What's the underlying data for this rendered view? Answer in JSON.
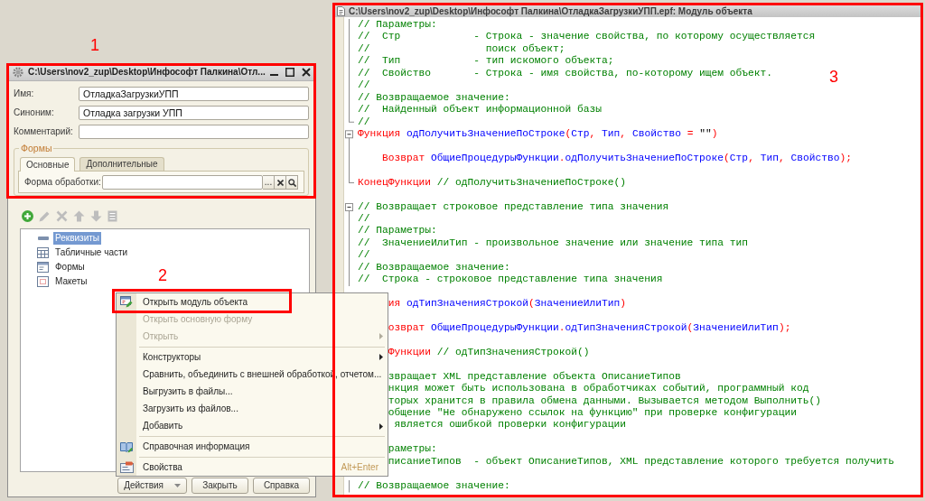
{
  "annotations": [
    {
      "number": "1"
    },
    {
      "number": "2"
    },
    {
      "number": "3"
    }
  ],
  "properties_window": {
    "title": "C:\\Users\\nov2_zup\\Desktop\\Инфософт Палкина\\Отл...",
    "fields": [
      {
        "label": "Имя:",
        "value": "ОтладкаЗагрузкиУПП"
      },
      {
        "label": "Синоним:",
        "value": "Отладка загрузки УПП"
      },
      {
        "label": "Комментарий:"
      }
    ],
    "group": {
      "title": "Формы",
      "tabs": [
        {
          "label": "Основные",
          "selected": true
        },
        {
          "label": "Дополнительные",
          "selected": false
        }
      ],
      "field": {
        "label": "Форма обработки:",
        "choose_button": "..."
      }
    },
    "toolbar": [
      {
        "kind": "add",
        "disabled": false
      },
      {
        "kind": "edit",
        "disabled": true
      },
      {
        "kind": "delete",
        "disabled": true
      },
      {
        "kind": "up",
        "disabled": true
      },
      {
        "kind": "down",
        "disabled": true
      },
      {
        "kind": "list",
        "disabled": true
      }
    ],
    "tree": [
      {
        "kind": "attributes",
        "label": "Реквизиты",
        "selected": true
      },
      {
        "kind": "tables",
        "label": "Табличные части",
        "selected": false
      },
      {
        "kind": "forms",
        "label": "Формы",
        "selected": false
      },
      {
        "kind": "templates",
        "label": "Макеты",
        "selected": false
      }
    ],
    "buttons": [
      {
        "kind": "dropdown",
        "label": "Действия"
      },
      {
        "kind": "plain",
        "label": "Закрыть"
      },
      {
        "kind": "plain",
        "label": "Справка"
      }
    ]
  },
  "context_menu": {
    "items": [
      {
        "kind": "module",
        "label": "Открыть модуль объекта",
        "disabled": false,
        "submenu": false
      },
      {
        "kind": "command",
        "label": "Открыть основную форму",
        "disabled": true,
        "submenu": false
      },
      {
        "kind": "command",
        "label": "Открыть",
        "disabled": true,
        "submenu": true
      },
      {
        "kind": "separator"
      },
      {
        "kind": "command",
        "label": "Конструкторы",
        "disabled": false,
        "submenu": true
      },
      {
        "kind": "command",
        "label": "Сравнить, объединить с внешней обработкой, отчетом...",
        "disabled": false,
        "submenu": false
      },
      {
        "kind": "command",
        "label": "Выгрузить в файлы...",
        "disabled": false,
        "submenu": false
      },
      {
        "kind": "command",
        "label": "Загрузить из файлов...",
        "disabled": false,
        "submenu": false
      },
      {
        "kind": "command",
        "label": "Добавить",
        "disabled": false,
        "submenu": true
      },
      {
        "kind": "separator"
      },
      {
        "kind": "help",
        "label": "Справочная информация",
        "disabled": false,
        "submenu": false
      },
      {
        "kind": "separator"
      },
      {
        "kind": "properties",
        "label": "Свойства",
        "disabled": false,
        "submenu": false,
        "shortcut": "Alt+Enter"
      }
    ]
  },
  "code_window": {
    "title": "C:\\Users\\nov2_zup\\Desktop\\Инфософт Палкина\\ОтладкаЗагрузкиУПП.epf: Модуль объекта",
    "lines": [
      {
        "kind": "region",
        "has_toggle": false,
        "has_end": true,
        "children": [
          {
            "kind": "comment",
            "text": "// Параметры:",
            "covered": false
          },
          {
            "kind": "comment",
            "text": "//  Стр            - Строка - значение свойства, по которому осуществляется",
            "covered": false
          },
          {
            "kind": "comment",
            "text": "//                   поиск объект;",
            "covered": false
          },
          {
            "kind": "comment",
            "text": "//  Тип            - тип искомого объекта;",
            "covered": false
          },
          {
            "kind": "comment",
            "text": "//  Свойство       - Строка - имя свойства, по-которому ищем объект.",
            "covered": false
          },
          {
            "kind": "comment",
            "text": "//",
            "covered": false
          },
          {
            "kind": "comment",
            "text": "// Возвращаемое значение:",
            "covered": false
          },
          {
            "kind": "comment",
            "text": "//  Найденный объект информационной базы",
            "covered": false
          },
          {
            "kind": "comment",
            "text": "//",
            "covered": false
          }
        ]
      },
      {
        "kind": "region",
        "has_toggle": true,
        "has_end": true,
        "children": [
          {
            "kind": "code",
            "tokens": [
              {
                "kind": "keyword",
                "text": "Функция"
              },
              {
                "kind": "name",
                "text": " одПолучитьЗначениеПоСтроке"
              },
              {
                "kind": "op",
                "text": "("
              },
              {
                "kind": "name",
                "text": "Стр"
              },
              {
                "kind": "op",
                "text": ","
              },
              {
                "kind": "name",
                "text": " Тип"
              },
              {
                "kind": "op",
                "text": ","
              },
              {
                "kind": "name",
                "text": " Свойство "
              },
              {
                "kind": "op",
                "text": "="
              },
              {
                "kind": "string",
                "text": " \"\""
              },
              {
                "kind": "op",
                "text": ")"
              }
            ],
            "covered": false
          },
          {
            "kind": "blank"
          },
          {
            "kind": "code",
            "tokens": [
              {
                "kind": "keyword",
                "text": "    Возврат"
              },
              {
                "kind": "name",
                "text": " ОбщиеПроцедурыФункции"
              },
              {
                "kind": "op",
                "text": "."
              },
              {
                "kind": "name",
                "text": "одПолучитьЗначениеПоСтроке"
              },
              {
                "kind": "op",
                "text": "("
              },
              {
                "kind": "name",
                "text": "Стр"
              },
              {
                "kind": "op",
                "text": ","
              },
              {
                "kind": "name",
                "text": " Тип"
              },
              {
                "kind": "op",
                "text": ","
              },
              {
                "kind": "name",
                "text": " Свойство"
              },
              {
                "kind": "op",
                "text": ");"
              }
            ],
            "covered": false
          },
          {
            "kind": "blank"
          },
          {
            "kind": "code",
            "tokens": [
              {
                "kind": "keyword",
                "text": "КонецФункции"
              },
              {
                "kind": "comment",
                "text": " // одПолучитьЗначениеПоСтроке()"
              }
            ],
            "covered": false
          }
        ]
      },
      {
        "kind": "blank"
      },
      {
        "kind": "region",
        "has_toggle": true,
        "has_end": false,
        "children": [
          {
            "kind": "comment",
            "text": "// Возвращает строковое представление типа значения",
            "covered": false
          },
          {
            "kind": "comment",
            "text": "//",
            "covered": false
          },
          {
            "kind": "comment",
            "text": "// Параметры:",
            "covered": false
          },
          {
            "kind": "comment",
            "text": "//  ЗначениеИлиТип - произвольное значение или значение типа тип",
            "covered": false
          },
          {
            "kind": "comment",
            "text": "//",
            "covered": false
          },
          {
            "kind": "comment",
            "text": "// Возвращаемое значение:",
            "covered": false
          },
          {
            "kind": "comment",
            "text": "//  Строка - строковое представление типа значения",
            "covered": false
          }
        ]
      },
      {
        "kind": "blank"
      },
      {
        "kind": "code",
        "tokens": [
          {
            "kind": "keyword",
            "text": "ия"
          },
          {
            "kind": "name",
            "text": " одТипЗначенияСтрокой"
          },
          {
            "kind": "op",
            "text": "("
          },
          {
            "kind": "name",
            "text": "ЗначениеИлиТип"
          },
          {
            "kind": "op",
            "text": ")"
          }
        ],
        "covered": true
      },
      {
        "kind": "blank"
      },
      {
        "kind": "code",
        "tokens": [
          {
            "kind": "keyword",
            "text": "озврат"
          },
          {
            "kind": "name",
            "text": " ОбщиеПроцедурыФункции"
          },
          {
            "kind": "op",
            "text": "."
          },
          {
            "kind": "name",
            "text": "одТипЗначенияСтрокой"
          },
          {
            "kind": "op",
            "text": "("
          },
          {
            "kind": "name",
            "text": "ЗначениеИлиТип"
          },
          {
            "kind": "op",
            "text": ");"
          }
        ],
        "covered": true
      },
      {
        "kind": "blank"
      },
      {
        "kind": "code",
        "tokens": [
          {
            "kind": "keyword",
            "text": "Функции"
          },
          {
            "kind": "comment",
            "text": " // одТипЗначенияСтрокой()"
          }
        ],
        "covered": true
      },
      {
        "kind": "blank"
      },
      {
        "kind": "comment",
        "text": "звращает XML представление объекта ОписаниеТипов",
        "covered": true
      },
      {
        "kind": "comment",
        "text": "нкция может быть использована в обработчиках событий, программный код",
        "covered": true
      },
      {
        "kind": "comment",
        "text": "торых хранится в правила обмена данными. Вызывается методом Выполнить()",
        "covered": true
      },
      {
        "kind": "comment",
        "text": "общение \"Не обнаружено ссылок на функцию\" при проверке конфигурации",
        "covered": true
      },
      {
        "kind": "comment",
        "text": " является ошибкой проверки конфигурации",
        "covered": true
      },
      {
        "kind": "blank"
      },
      {
        "kind": "comment",
        "text": "раметры:",
        "covered": true
      },
      {
        "kind": "comment",
        "text": "писаниеТипов  - объект ОписаниеТипов, XML представление которого требуется получить",
        "covered": true
      },
      {
        "kind": "blank"
      },
      {
        "kind": "region",
        "has_toggle": false,
        "has_end": false,
        "children": [
          {
            "kind": "comment",
            "text": "// Возвращаемое значение:",
            "covered": false
          }
        ]
      }
    ]
  }
}
